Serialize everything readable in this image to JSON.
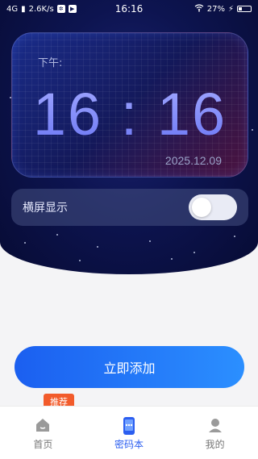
{
  "status_bar": {
    "network": "4G",
    "speed": "2.6K/s",
    "time": "16:16",
    "battery": "27%",
    "battery_level": 0.27
  },
  "clock": {
    "period": "下午:",
    "time": "16 : 16",
    "date": "2025.12.09"
  },
  "landscape": {
    "label": "横屏显示",
    "enabled": false
  },
  "actions": {
    "add_label": "立即添加"
  },
  "badge": {
    "recommend": "推荐"
  },
  "tabs": [
    {
      "label": "首页",
      "icon": "home-icon"
    },
    {
      "label": "密码本",
      "icon": "password-book-icon"
    },
    {
      "label": "我的",
      "icon": "user-icon"
    }
  ],
  "colors": {
    "accent": "#2b5ef0",
    "badge": "#f25b2b"
  }
}
